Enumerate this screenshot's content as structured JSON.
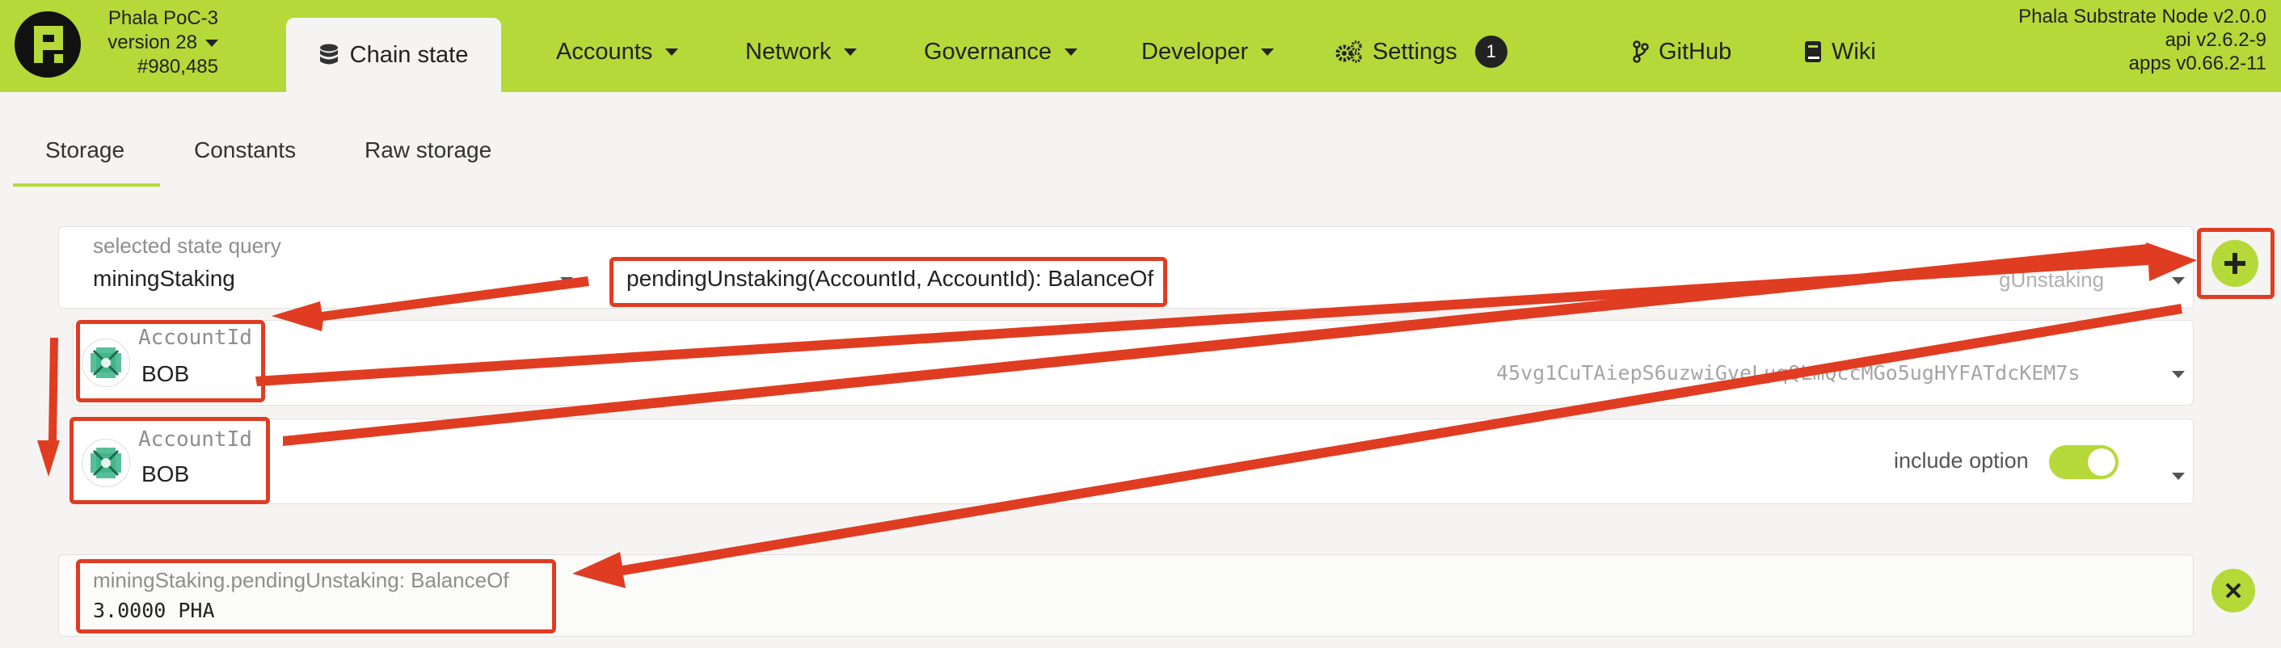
{
  "header": {
    "chain_name": "Phala PoC-3",
    "version": "version 28",
    "block": "#980,485",
    "active_tab": {
      "label": "Chain state",
      "icon": "database-icon"
    },
    "nav": [
      {
        "label": "Accounts",
        "has_dropdown": true
      },
      {
        "label": "Network",
        "has_dropdown": true
      },
      {
        "label": "Governance",
        "has_dropdown": true
      },
      {
        "label": "Developer",
        "has_dropdown": true
      },
      {
        "label": "Settings",
        "icon": "gears-icon",
        "badge": "1"
      },
      {
        "label": "GitHub",
        "icon": "code-branch-icon"
      },
      {
        "label": "Wiki",
        "icon": "book-icon"
      }
    ],
    "node_info": {
      "line1": "Phala Substrate Node v2.0.0",
      "line2": "api v2.6.2-9",
      "line3": "apps v0.66.2-11"
    }
  },
  "subtabs": {
    "items": [
      "Storage",
      "Constants",
      "Raw storage"
    ],
    "active": "Storage"
  },
  "query": {
    "label": "selected state query",
    "module": "miningStaking",
    "method": "pendingUnstaking(AccountId, AccountId): BalanceOf",
    "method_overflow": "gUnstaking"
  },
  "params": [
    {
      "label": "AccountId",
      "name": "BOB",
      "address": "45vg1CuTAiepS6uzwiGveLuqQLmQccMGo5ugHYFATdcKEM7s"
    },
    {
      "label": "AccountId",
      "name": "BOB",
      "include_option_label": "include option",
      "include_option": true
    }
  ],
  "result": {
    "label": "miningStaking.pendingUnstaking: BalanceOf",
    "value": "3.0000 PHA"
  },
  "buttons": {
    "add": "+",
    "remove": "×"
  },
  "colors": {
    "accent": "#b4d939",
    "annotation": "#e03c22",
    "background": "#f5f4f3"
  }
}
